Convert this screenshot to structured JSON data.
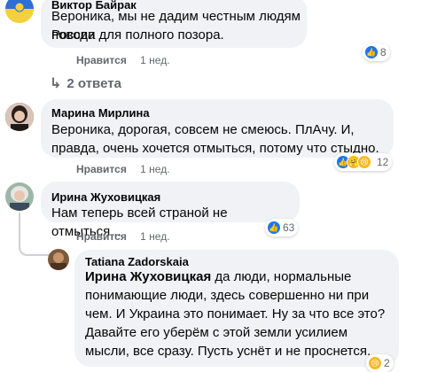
{
  "comments": [
    {
      "author": "Виктор Байрак",
      "text_lines": [
        "Вероника, мы не дадим честным людям России",
        "повода для полного позора."
      ],
      "like_label": "Нравится",
      "age": "1 нед.",
      "reaction_count": "8",
      "reactions": [
        "like-icon"
      ]
    },
    {
      "replies_label": "2 ответа"
    },
    {
      "author": "Марина Мирлина",
      "text_lines": [
        "Вероника, дорогая, совсем не смеюсь. ПлАчу. И,",
        "правда, очень хочется отмыться, потому что стыдно."
      ],
      "like_label": "Нравится",
      "age": "1 нед.",
      "reaction_count": "12",
      "reactions": [
        "like-icon",
        "care-icon",
        "sad-icon"
      ]
    },
    {
      "author": "Ирина Жуховицкая",
      "text_lines": [
        "Нам теперь всей страной не отмыться..."
      ],
      "like_label": "Нравится",
      "age": "1 нед.",
      "reaction_count": "63",
      "reactions": [
        "like-icon"
      ]
    },
    {
      "author": "Tatiana Zadorskaia",
      "mention": "Ирина Жуховицкая",
      "text_first_rest": " да люди, нормальные",
      "text_lines": [
        "понимающие люди, здесь совершенно ни при",
        "чем. И Украина это понимает. Ну за что все это?",
        "Давайте его уберём с этой земли усилием",
        "мысли, все сразу. Пусть уснёт и не проснется."
      ],
      "reaction_count": "2",
      "reactions": [
        "sad-icon"
      ]
    }
  ],
  "colors": {
    "bubble": "#f0f2f5",
    "meta": "#65676b",
    "like_blue": "#1877f2"
  }
}
